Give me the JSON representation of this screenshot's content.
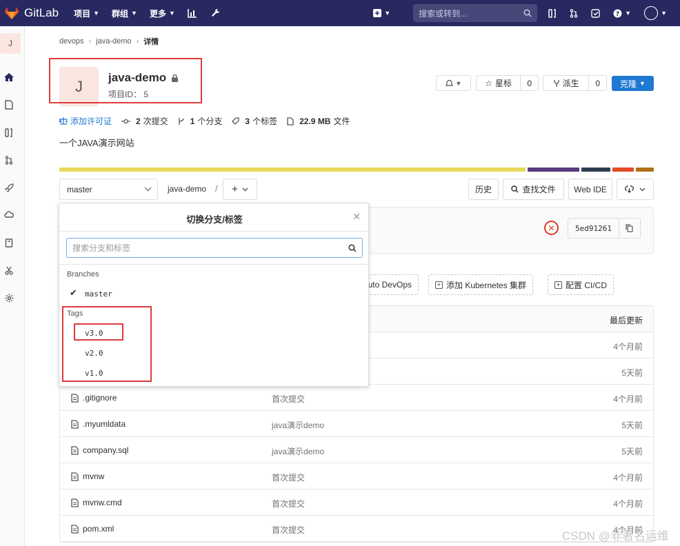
{
  "nav": {
    "brand": "GitLab",
    "menu": [
      "项目",
      "群组",
      "更多"
    ],
    "search_placeholder": "搜索或转到..."
  },
  "sidebar": {
    "avatar_letter": "J"
  },
  "breadcrumb": [
    "devops",
    "java-demo",
    "详情"
  ],
  "project": {
    "avatar_letter": "J",
    "name": "java-demo",
    "id_label": "项目ID： 5",
    "notify_label": "",
    "star_label": "星标",
    "star_count": "0",
    "fork_label": "派生",
    "fork_count": "0",
    "clone_label": "克隆"
  },
  "stats": {
    "license": "添加许可证",
    "commits_num": "2",
    "commits_label": "次提交",
    "branches_num": "1",
    "branches_label": "个分支",
    "tags_num": "3",
    "tags_label": "个标签",
    "size_num": "22.9 MB",
    "size_label": "文件"
  },
  "description": "一个JAVA演示网站",
  "lang_colors": [
    "#e8d95a",
    "#563d7c",
    "#2c3e50",
    "#e34c26",
    "#b07219"
  ],
  "toolbar": {
    "branch": "master",
    "path": "java-demo",
    "path_sep": "/",
    "history": "历史",
    "find_file": "查找文件",
    "web_ide": "Web IDE"
  },
  "commit": {
    "sha": "5ed91261"
  },
  "actions": {
    "auto_devops": "uto DevOps",
    "k8s": "添加 Kubernetes 集群",
    "cicd": "配置 CI/CD"
  },
  "tree": {
    "last_update_label": "最后更新",
    "rows": [
      {
        "name": "",
        "msg": "",
        "time": "4个月前"
      },
      {
        "name": "",
        "msg": "",
        "time": "5天前"
      },
      {
        "name": ".gitignore",
        "msg": "首次提交",
        "time": "4个月前"
      },
      {
        "name": ".myumldata",
        "msg": "java演示demo",
        "time": "5天前"
      },
      {
        "name": "company.sql",
        "msg": "java演示demo",
        "time": "5天前"
      },
      {
        "name": "mvnw",
        "msg": "首次提交",
        "time": "4个月前"
      },
      {
        "name": "mvnw.cmd",
        "msg": "首次提交",
        "time": "4个月前"
      },
      {
        "name": "pom.xml",
        "msg": "首次提交",
        "time": "4个月前"
      }
    ]
  },
  "dropdown": {
    "title": "切换分支/标签",
    "search_placeholder": "搜索分支和标签",
    "branches_label": "Branches",
    "branches": [
      "master"
    ],
    "tags_label": "Tags",
    "tags": [
      "v3.0",
      "v2.0",
      "v1.0"
    ]
  },
  "watermark": "CSDN @非著名运维"
}
